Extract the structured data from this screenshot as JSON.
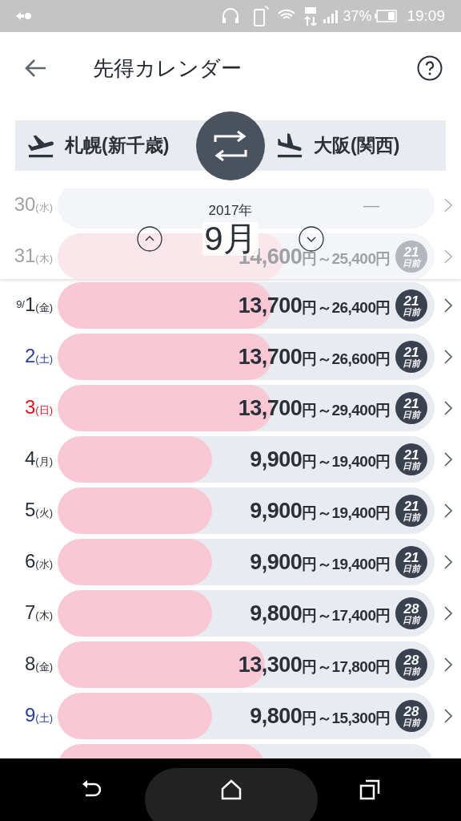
{
  "status_bar": {
    "battery": "37%",
    "time": "19:09"
  },
  "header": {
    "title": "先得カレンダー"
  },
  "route": {
    "from": "札幌(新千歳)",
    "to": "大阪(関西)"
  },
  "faded_rows": [
    {
      "day": "30",
      "weekday": "(水)",
      "kind": "empty",
      "price": "—"
    },
    {
      "day": "31",
      "weekday": "(木)",
      "kind": "fare",
      "price": "14,600",
      "range": "円～25,400円",
      "badge_number": "21",
      "badge_unit": "日前",
      "level": 0.6
    }
  ],
  "month_picker": {
    "year": "2017年",
    "month": "9月"
  },
  "rows": [
    {
      "month_prefix": "9/",
      "day": "1",
      "weekday": "(金)",
      "kind": "weekday",
      "price": "13,700",
      "range": "円～26,400円",
      "badge_number": "21",
      "badge_unit": "日前",
      "level": 0.57
    },
    {
      "day": "2",
      "weekday": "(土)",
      "kind": "saturday",
      "price": "13,700",
      "range": "円～26,600円",
      "badge_number": "21",
      "badge_unit": "日前",
      "level": 0.57
    },
    {
      "day": "3",
      "weekday": "(日)",
      "kind": "sunday",
      "price": "13,700",
      "range": "円～29,400円",
      "badge_number": "21",
      "badge_unit": "日前",
      "level": 0.57
    },
    {
      "day": "4",
      "weekday": "(月)",
      "kind": "weekday",
      "price": "9,900",
      "range": "円～19,400円",
      "badge_number": "21",
      "badge_unit": "日前",
      "level": 0.41
    },
    {
      "day": "5",
      "weekday": "(火)",
      "kind": "weekday",
      "price": "9,900",
      "range": "円～19,400円",
      "badge_number": "21",
      "badge_unit": "日前",
      "level": 0.41
    },
    {
      "day": "6",
      "weekday": "(水)",
      "kind": "weekday",
      "price": "9,900",
      "range": "円～19,400円",
      "badge_number": "21",
      "badge_unit": "日前",
      "level": 0.41
    },
    {
      "day": "7",
      "weekday": "(木)",
      "kind": "weekday",
      "price": "9,800",
      "range": "円～17,400円",
      "badge_number": "28",
      "badge_unit": "日前",
      "level": 0.41
    },
    {
      "day": "8",
      "weekday": "(金)",
      "kind": "weekday",
      "price": "13,300",
      "range": "円～17,800円",
      "badge_number": "28",
      "badge_unit": "日前",
      "level": 0.55
    },
    {
      "day": "9",
      "weekday": "(土)",
      "kind": "saturday",
      "price": "9,800",
      "range": "円～15,300円",
      "badge_number": "28",
      "badge_unit": "日前",
      "level": 0.41
    }
  ],
  "partial_row": {
    "level": 0.55
  }
}
